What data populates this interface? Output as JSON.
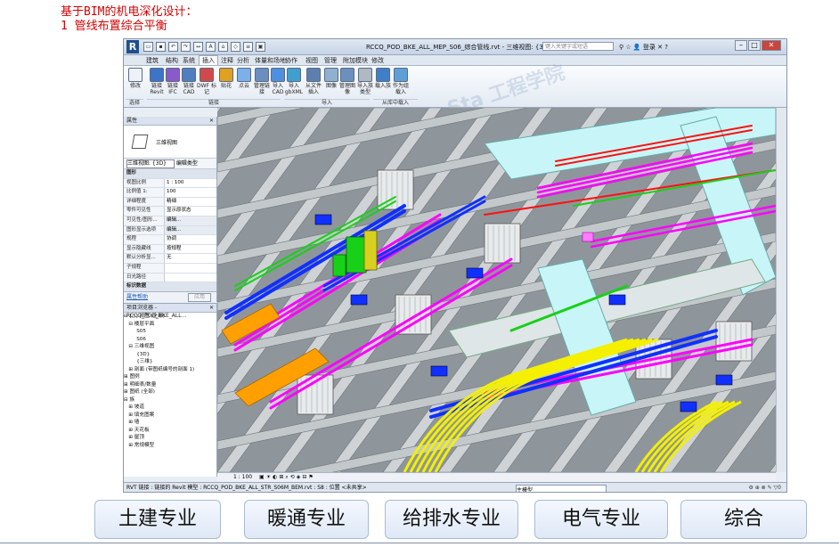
{
  "slide": {
    "title_line1": "基于BIM的机电深化设计：",
    "title_line2": "1 管线布置综合平衡"
  },
  "window": {
    "app_logo": "R",
    "doc_title": "RCCQ_POD_BKE_ALL_MEP_S06_综合管线.rvt - 三维视图: {3D}",
    "search_placeholder": "键入关键字或短语",
    "login_label": "登录",
    "help_label": "?"
  },
  "tabs": [
    "建筑",
    "结构",
    "系统",
    "插入",
    "注释",
    "分析",
    "体量和场地",
    "协作",
    "视图",
    "管理",
    "附加模块",
    "修改"
  ],
  "active_tab": "插入",
  "ribbon": {
    "buttons": [
      {
        "label": "修改",
        "icon": "cursor-icon"
      },
      {
        "label": "链接 Revit",
        "icon": "link-revit-icon"
      },
      {
        "label": "链接 IFC",
        "icon": "link-ifc-icon"
      },
      {
        "label": "链接 CAD",
        "icon": "link-cad-icon"
      },
      {
        "label": "DWF 标记",
        "icon": "dwf-icon"
      },
      {
        "label": "贴花",
        "icon": "decal-icon"
      },
      {
        "label": "点云",
        "icon": "point-cloud-icon"
      },
      {
        "label": "管理链接",
        "icon": "manage-links-icon"
      },
      {
        "label": "导入 CAD",
        "icon": "import-cad-icon"
      },
      {
        "label": "导入 gbXML",
        "icon": "gbxml-icon"
      },
      {
        "label": "从文件插入",
        "icon": "insert-file-icon"
      },
      {
        "label": "图像",
        "icon": "image-icon"
      },
      {
        "label": "管理图像",
        "icon": "manage-images-icon"
      },
      {
        "label": "导入族类型",
        "icon": "family-types-icon"
      },
      {
        "label": "载入族",
        "icon": "load-family-icon"
      },
      {
        "label": "作为组载入",
        "icon": "load-group-icon"
      }
    ],
    "groups": {
      "select": "选择",
      "link": "链接",
      "import": "导入",
      "library": "从库中载入"
    }
  },
  "properties": {
    "header": "属性",
    "view_name": "三维视图",
    "view_selector": "三维视图: {3D}",
    "edit_type": "编辑类型",
    "section_graphics": "图形",
    "rows": [
      {
        "k": "视图比例",
        "v": "1 : 100"
      },
      {
        "k": "比例值 1:",
        "v": "100"
      },
      {
        "k": "详细程度",
        "v": "精细"
      },
      {
        "k": "零件可见性",
        "v": "显示原状态"
      },
      {
        "k": "可见性/图形...",
        "v": "编辑..."
      },
      {
        "k": "图形显示选项",
        "v": "编辑..."
      },
      {
        "k": "规程",
        "v": "协调"
      },
      {
        "k": "显示隐藏线",
        "v": "按规程"
      },
      {
        "k": "默认分析显...",
        "v": "无"
      },
      {
        "k": "子规程",
        "v": ""
      },
      {
        "k": "日光路径",
        "v": ""
      }
    ],
    "section_extents": "标识数据",
    "help_link": "属性帮助",
    "apply_button": "应用"
  },
  "browser": {
    "header": "项目浏览器 - RCCQ_POD_BKE_ALL...",
    "items": [
      "⊟ [○] 视图 (全部)",
      "   ⊟ 楼层平面",
      "        S05",
      "        S06",
      "   ⊟ 三维视图",
      "        {3D}",
      "        {三维}",
      "   ⊞ 剖面 (带图纸编号的剖面 1)",
      "⊞ 图例",
      "⊞ 明细表/数量",
      "⊞ 图纸 (全部)",
      "⊟ 族",
      "   ⊞ 坡道",
      "   ⊞ 填充图案",
      "   ⊞ 墙",
      "   ⊞ 天花板",
      "   ⊞ 屋顶",
      "   ⊞ 常规模型"
    ]
  },
  "viewbar": {
    "scale": "1 : 100"
  },
  "statusbar": {
    "text": "RVT 链接 : 链接的 Revit 模型 : RCCQ_POD_BKE_ALL_STR_S06M_BEM.rvt : S8 : 位置 <未共享>",
    "model": "主模型",
    "filter": "0"
  },
  "categories": [
    {
      "label": "土建专业"
    },
    {
      "label": "暖通专业"
    },
    {
      "label": "给排水专业"
    },
    {
      "label": "电气专业"
    },
    {
      "label": "综合"
    }
  ],
  "colors": {
    "title_red": "#d40000",
    "pipe_magenta": "#ff00ff",
    "pipe_blue": "#1030ff",
    "pipe_green": "#18d018",
    "pipe_yellow": "#f4f000",
    "pipe_orange": "#ffa000",
    "pipe_red": "#ff1010",
    "duct_cyan": "#c8f6f8"
  }
}
